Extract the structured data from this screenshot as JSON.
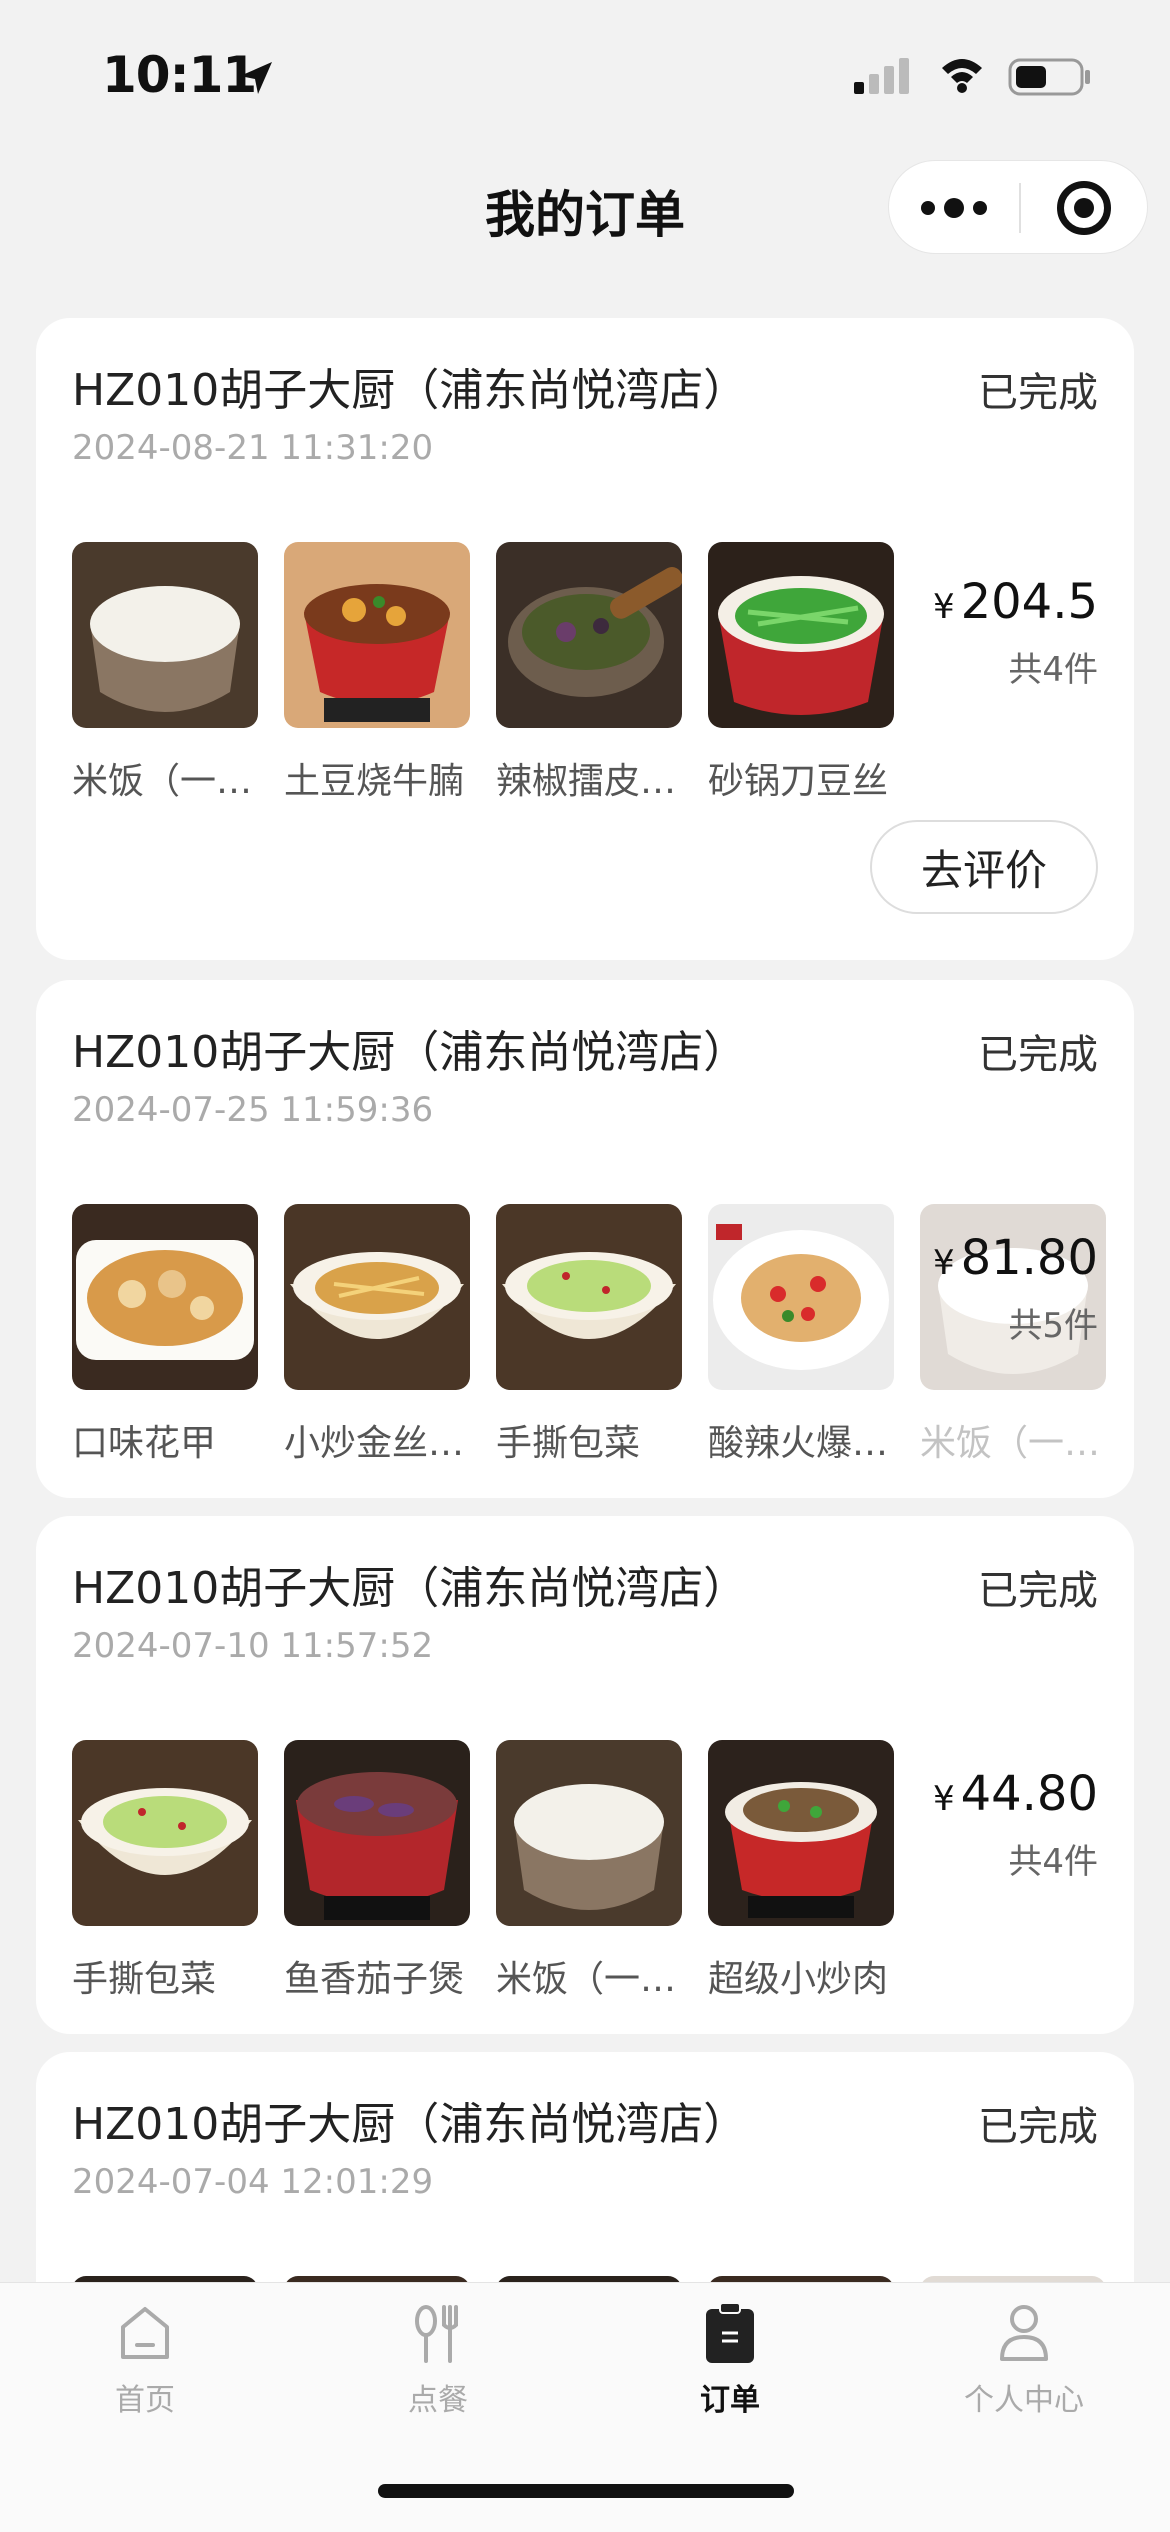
{
  "status_bar": {
    "time": "10:11"
  },
  "nav": {
    "title": "我的订单"
  },
  "orders": [
    {
      "store": "HZ010胡子大厨（浦东尚悦湾店）",
      "status": "已完成",
      "datetime": "2024-08-21 11:31:20",
      "items": [
        "米饭（一…",
        "土豆烧牛腩",
        "辣椒擂皮…",
        "砂锅刀豆丝"
      ],
      "currency": "¥",
      "total": "204.5",
      "count": "共4件",
      "review_label": "去评价"
    },
    {
      "store": "HZ010胡子大厨（浦东尚悦湾店）",
      "status": "已完成",
      "datetime": "2024-07-25 11:59:36",
      "items": [
        "口味花甲",
        "小炒金丝…",
        "手撕包菜",
        "酸辣火爆…",
        "米饭（一…"
      ],
      "currency": "¥",
      "total": "81.80",
      "count": "共5件"
    },
    {
      "store": "HZ010胡子大厨（浦东尚悦湾店）",
      "status": "已完成",
      "datetime": "2024-07-10 11:57:52",
      "items": [
        "手撕包菜",
        "鱼香茄子煲",
        "米饭（一…",
        "超级小炒肉"
      ],
      "currency": "¥",
      "total": "44.80",
      "count": "共4件"
    },
    {
      "store": "HZ010胡子大厨（浦东尚悦湾店）",
      "status": "已完成",
      "datetime": "2024-07-04 12:01:29"
    }
  ],
  "tabs": [
    {
      "label": "首页",
      "icon": "home-icon"
    },
    {
      "label": "点餐",
      "icon": "utensils-icon"
    },
    {
      "label": "订单",
      "icon": "clipboard-icon",
      "active": true
    },
    {
      "label": "个人中心",
      "icon": "user-icon"
    }
  ],
  "colors": {
    "background": "#f2f2f2",
    "card": "#ffffff",
    "active_tab": "#111111",
    "inactive_tab": "#aaaaaa"
  }
}
